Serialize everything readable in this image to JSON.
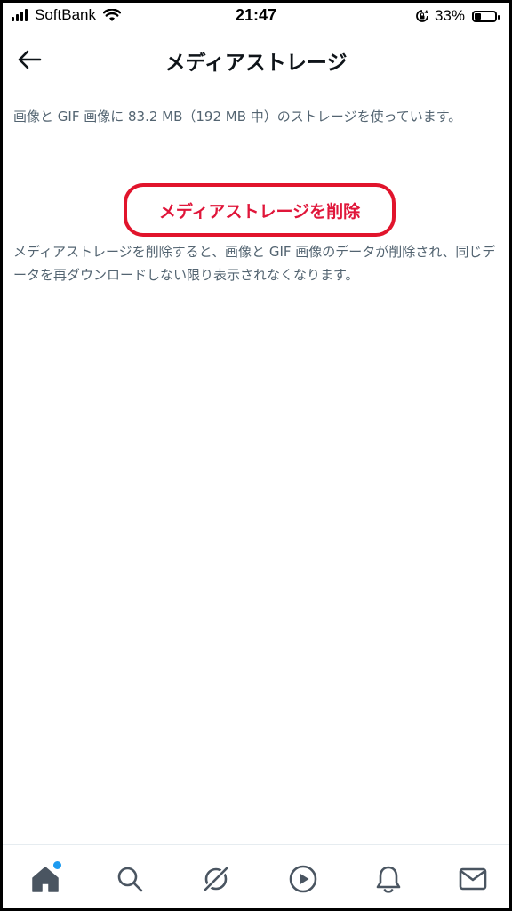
{
  "status_bar": {
    "carrier": "SoftBank",
    "time": "21:47",
    "battery_percent_label": "33%",
    "battery_level": 0.33
  },
  "header": {
    "title": "メディアストレージ",
    "back_icon": "arrow-left-icon"
  },
  "content": {
    "usage_text": "画像と GIF 画像に 83.2 MB（192 MB 中）のストレージを使っています。",
    "delete_button_label": "メディアストレージを削除",
    "delete_note": "メディアストレージを削除すると、画像と GIF 画像のデータが削除され、同じデータを再ダウンロードしない限り表示されなくなります。"
  },
  "bottom_nav": {
    "items": [
      {
        "icon": "home-icon",
        "active": true,
        "has_notification_dot": true
      },
      {
        "icon": "search-icon",
        "active": false
      },
      {
        "icon": "spaces-icon",
        "active": false
      },
      {
        "icon": "play-icon",
        "active": false
      },
      {
        "icon": "bell-icon",
        "active": false
      },
      {
        "icon": "mail-icon",
        "active": false
      }
    ]
  },
  "colors": {
    "highlight_border": "#e1142c",
    "delete_text": "#e0163a",
    "secondary_text": "#536471",
    "notification_dot": "#1d9bf0"
  }
}
